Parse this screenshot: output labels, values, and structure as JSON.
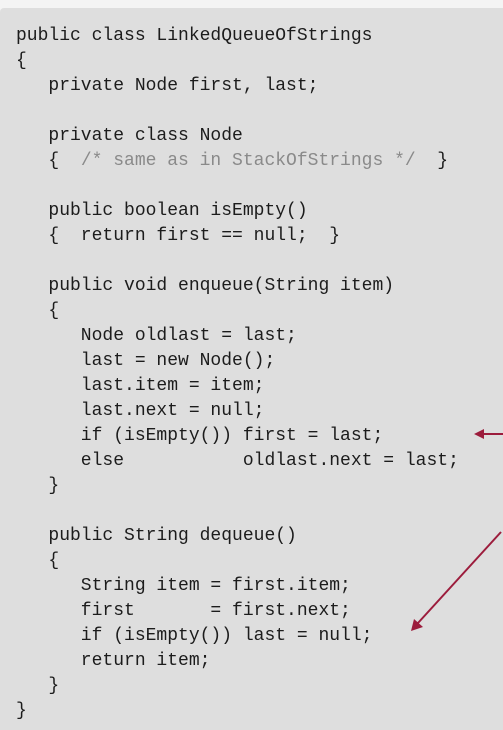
{
  "code": {
    "lines": [
      "public class LinkedQueueOfStrings",
      "{",
      "   private Node first, last;",
      "",
      "   private class Node",
      "",
      "",
      "   public boolean isEmpty()",
      "   {  return first == null;  }",
      "",
      "   public void enqueue(String item)",
      "   {",
      "      Node oldlast = last;",
      "      last = new Node();",
      "      last.item = item;",
      "      last.next = null;",
      "      if (isEmpty()) first = last;",
      "      else           oldlast.next = last;",
      "   }",
      "",
      "   public String dequeue()",
      "   {",
      "      String item = first.item;",
      "      first       = first.next;",
      "      if (isEmpty()) last = null;",
      "      return item;",
      "   }",
      "}"
    ],
    "node_line": {
      "open": "   {  ",
      "comment": "/* same as in StackOfStrings */",
      "close": "  }"
    }
  },
  "colors": {
    "arrow": "#9c1c3c",
    "panel": "#dedede",
    "comment": "#8a8a8a"
  }
}
